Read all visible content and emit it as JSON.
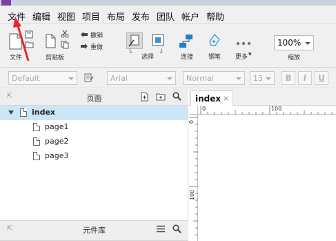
{
  "menu": {
    "items": [
      "文件",
      "编辑",
      "视图",
      "项目",
      "布局",
      "发布",
      "团队",
      "帐户",
      "帮助"
    ]
  },
  "toolbar": {
    "file_label": "文件",
    "clipboard_label": "剪贴板",
    "undo_label": "撤销",
    "redo_label": "重做",
    "select_label": "选择",
    "connect_label": "连接",
    "pen_label": "钢笔",
    "more_label": "更多",
    "more_arrow": "▾",
    "zoom_value": "100%",
    "zoom_label": "缩放",
    "select_bracket_left": "└",
    "select_bracket_right": "┘"
  },
  "format": {
    "style_placeholder": "Default",
    "font_value": "Arial",
    "weight_value": "Normal",
    "size_value": "13",
    "bold_label": "B",
    "italic_label": "I",
    "underline_label": "U"
  },
  "pages_panel": {
    "title": "页面",
    "root": "index",
    "children": [
      "page1",
      "page2",
      "page3"
    ]
  },
  "widgets_panel": {
    "title": "元件库"
  },
  "canvas": {
    "tab_label": "index",
    "tab_close": "×",
    "ruler_h": [
      "0",
      "100"
    ],
    "ruler_v": [
      "0",
      "100"
    ]
  },
  "colors": {
    "accent_red": "#e5282e",
    "selection": "#cde6f7",
    "connect_blue": "#1e7fc9"
  }
}
